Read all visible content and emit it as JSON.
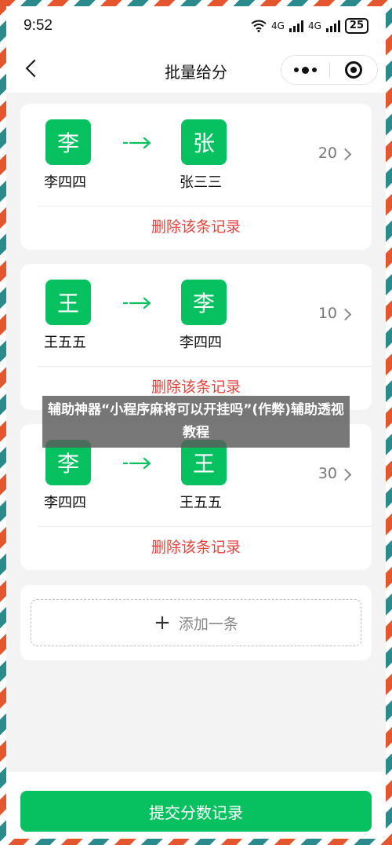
{
  "status_bar": {
    "time": "9:52",
    "network_1": "4G",
    "network_2": "4G",
    "battery": "25"
  },
  "navbar": {
    "title": "批量给分"
  },
  "records": [
    {
      "from_avatar": "李",
      "from_name": "李四四",
      "to_avatar": "张",
      "to_name": "张三三",
      "score": "20",
      "delete_label": "删除该条记录"
    },
    {
      "from_avatar": "王",
      "from_name": "王五五",
      "to_avatar": "李",
      "to_name": "李四四",
      "score": "10",
      "delete_label": "删除该条记录"
    },
    {
      "from_avatar": "李",
      "from_name": "李四四",
      "to_avatar": "王",
      "to_name": "王五五",
      "score": "30",
      "delete_label": "删除该条记录"
    }
  ],
  "add": {
    "plus": "+",
    "label": "添加一条"
  },
  "submit": {
    "label": "提交分数记录"
  },
  "watermark": {
    "text": "辅助神器“小程序麻将可以开挂吗”(作弊)辅助透视教程"
  },
  "colors": {
    "accent": "#07c160",
    "danger": "#e64340",
    "stripe_red": "#e4572e",
    "stripe_teal": "#2a8a8c"
  }
}
